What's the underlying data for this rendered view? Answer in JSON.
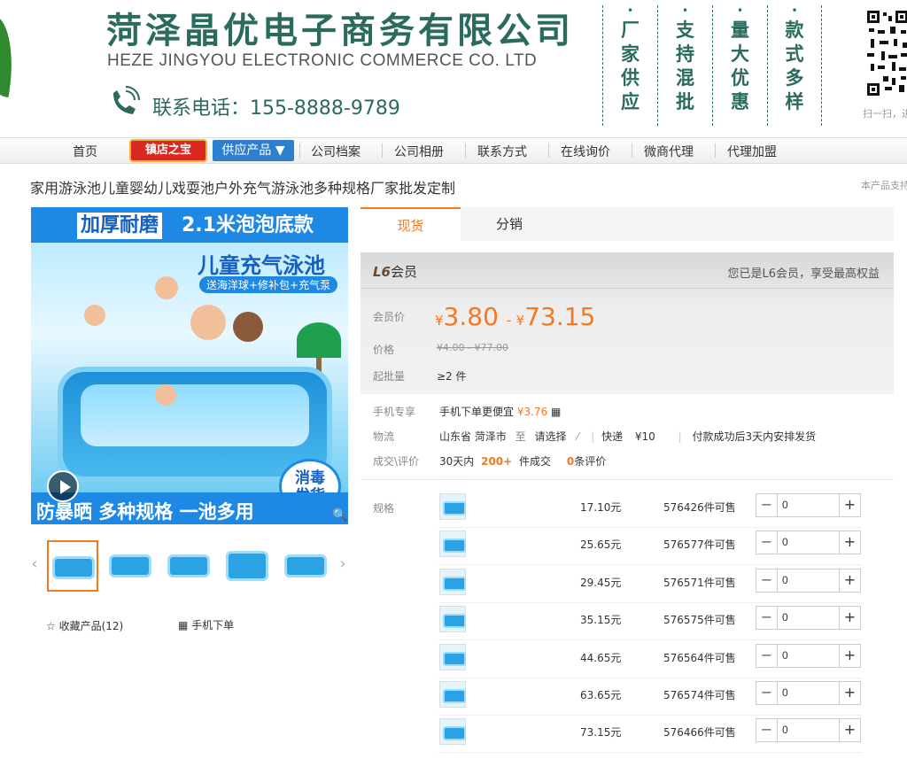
{
  "header": {
    "company_cn": "菏泽晶优电子商务有限公司",
    "company_en": "HEZE JINGYOU ELECTRONIC COMMERCE CO. LTD",
    "phone_label": "联系电话：155-8888-9789",
    "slogans": [
      "厂家供应",
      "支持混批",
      "量大优惠",
      "款式多样"
    ],
    "qr_caption": "扫一扫，进"
  },
  "nav": {
    "items": [
      "首页",
      "镇店之宝",
      "供应产品 ▼",
      "公司档案",
      "公司相册",
      "联系方式",
      "在线询价",
      "微商代理",
      "代理加盟"
    ]
  },
  "product": {
    "title": "家用游泳池儿童婴幼儿戏耍池户外充气游泳池多种规格厂家批发定制",
    "support_note": "本产品支持",
    "image": {
      "banner_a": "加厚耐磨",
      "banner_b": "2.1米泡泡底款",
      "subtitle": "儿童充气泳池",
      "subtitle2": "送海洋球+修补包+充气泵",
      "bottom": "防暴晒 多种规格 一池多用",
      "badge_line1": "消毒",
      "badge_line2": "发货"
    },
    "favorite": "收藏产品(12)",
    "mobile_order": "手机下单"
  },
  "tabs": {
    "active": "现货",
    "other": "分销"
  },
  "pricing": {
    "level": "L6",
    "level_suffix": "会员",
    "level_note": "您已是L6会员，享受最高权益",
    "member_label": "会员价",
    "member_low": "3.80",
    "member_high": "73.15",
    "currency": "¥",
    "price_label": "价格",
    "orig_range": "¥4.00 - ¥77.00",
    "min_label": "起批量",
    "min_value": "≥2 件"
  },
  "info": {
    "mobile_label": "手机专享",
    "mobile_text": "手机下单更便宜",
    "mobile_price": "¥3.76",
    "logistics_label": "物流",
    "origin": "山东省 菏泽市",
    "to": "至",
    "select": "请选择",
    "express": "快递",
    "express_fee": "¥10",
    "ship_note": "付款成功后3天内安排发货",
    "deal_label": "成交\\评价",
    "days": "30天内",
    "deals": "200+",
    "deals_suffix": "件成交",
    "reviews": "0",
    "reviews_suffix": "条评价"
  },
  "specs": {
    "label": "规格",
    "rows": [
      {
        "price": "17.10元",
        "stock": "576426件可售",
        "qty": "0"
      },
      {
        "price": "25.65元",
        "stock": "576577件可售",
        "qty": "0"
      },
      {
        "price": "29.45元",
        "stock": "576571件可售",
        "qty": "0"
      },
      {
        "price": "35.15元",
        "stock": "576575件可售",
        "qty": "0"
      },
      {
        "price": "44.65元",
        "stock": "576564件可售",
        "qty": "0"
      },
      {
        "price": "63.65元",
        "stock": "576574件可售",
        "qty": "0"
      },
      {
        "price": "73.15元",
        "stock": "576466件可售",
        "qty": "0"
      }
    ]
  },
  "colors": {
    "brand_green": "#2a6b5e",
    "accent_orange": "#f47920",
    "nav_blue": "#2f7fcf",
    "badge_red": "#d8281f"
  }
}
